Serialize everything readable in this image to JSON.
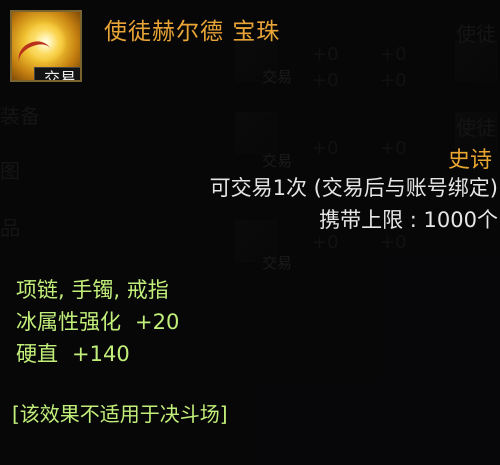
{
  "background": {
    "column_right_top": "使徒",
    "column_right_mid": "使徒",
    "left_fragments": [
      "装备",
      "图",
      "品"
    ],
    "stat_ghosts": [
      "+0",
      "+0",
      "+0",
      "+0",
      "+0",
      "+0",
      "+0",
      "+0"
    ],
    "trade_tags": [
      "交易",
      "交易",
      "交易"
    ]
  },
  "tooltip": {
    "item_name": "使徒赫尔德 宝珠",
    "icon_name": "orb-icon",
    "trade_badge": "交易",
    "rarity": "史诗",
    "trade_limit": "可交易1次 (交易后与账号绑定)",
    "carry_limit": "携带上限 : 1000个",
    "equip_slots": "项链, 手镯, 戒指",
    "stats": [
      {
        "name": "冰属性强化",
        "value": "+20"
      },
      {
        "name": "硬直",
        "value": "+140"
      }
    ],
    "effect_note": "[该效果不适用于决斗场]"
  },
  "colors": {
    "item_name": "#e9a437",
    "rarity_epic": "#e8a631",
    "stat_green": "#c2ef7a",
    "text_white": "#e6e6e6"
  }
}
